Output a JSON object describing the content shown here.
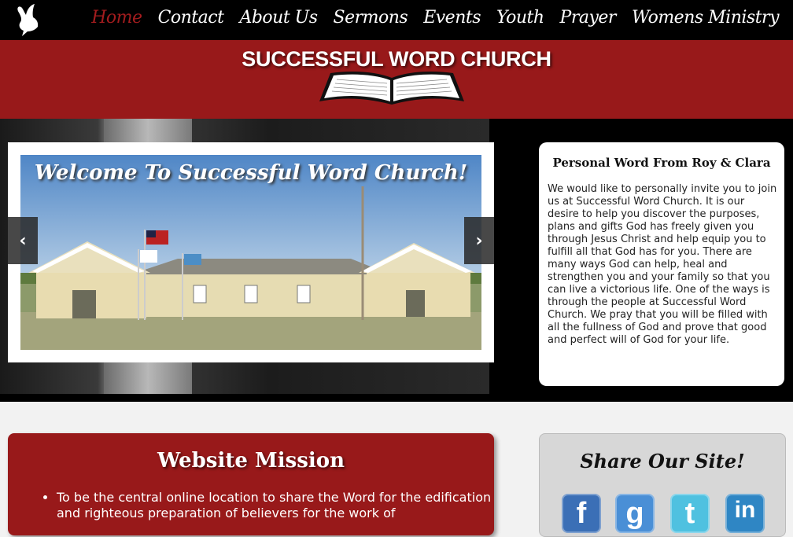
{
  "nav": {
    "items": [
      {
        "label": "Home",
        "active": true
      },
      {
        "label": "Contact",
        "active": false
      },
      {
        "label": "About Us",
        "active": false
      },
      {
        "label": "Sermons",
        "active": false
      },
      {
        "label": "Events",
        "active": false
      },
      {
        "label": "Youth",
        "active": false
      },
      {
        "label": "Prayer",
        "active": false
      },
      {
        "label": "Womens Ministry",
        "active": false
      }
    ],
    "logo_icon": "dove-icon"
  },
  "banner": {
    "title": "SUCCESSFUL WORD CHURCH",
    "icon": "open-bible-icon"
  },
  "slider": {
    "caption": "Welcome To Successful Word Church!",
    "prev_icon": "chevron-left",
    "next_icon": "chevron-right"
  },
  "personal_word": {
    "title": "Personal Word From Roy & Clara",
    "body": "We would like to personally invite you to join us at Successful Word Church. It is our desire to help you discover the purposes, plans and gifts God has freely given you through Jesus Christ and help equip you to fulfill all that God has for you. There are many ways God can help, heal and strengthen you and your family so that you can live a victorious life. One of the ways is through the people at Successful Word Church. We pray that you will be filled with all the fullness of God and prove that good and perfect will of God for your life."
  },
  "mission": {
    "title": "Website Mission",
    "items": [
      "To be the central online location to share the Word for the edification and righteous preparation of believers for the work of"
    ]
  },
  "share": {
    "title": "Share Our Site!",
    "icons": [
      {
        "name": "facebook-icon",
        "glyph": "f",
        "color": "#3b6fb6"
      },
      {
        "name": "google-icon",
        "glyph": "g",
        "color": "#4a8fd6"
      },
      {
        "name": "twitter-icon",
        "glyph": "t",
        "color": "#4fc1e0"
      },
      {
        "name": "linkedin-icon",
        "glyph": "in",
        "color": "#2f86c4"
      }
    ]
  },
  "colors": {
    "brand_red": "#98191a",
    "active_nav": "#a31c1e",
    "nav_bg": "#000000"
  }
}
